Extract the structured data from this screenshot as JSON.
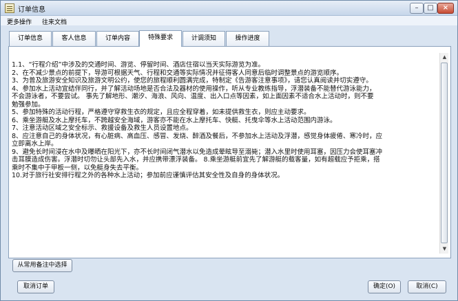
{
  "window": {
    "title": "订单信息",
    "buttons": {
      "minimize": "–",
      "maximize": "□",
      "close": "×"
    }
  },
  "menu": {
    "items": [
      "更多操作",
      "往来文档"
    ]
  },
  "tabs": [
    {
      "label": "订单信息"
    },
    {
      "label": "客人信息"
    },
    {
      "label": "订单内容"
    },
    {
      "label": "特殊要求"
    },
    {
      "label": "计调须知"
    },
    {
      "label": "操作进度"
    }
  ],
  "content": {
    "lines": [
      "1.1、“行程介绍”中涉及的交通时间、游览、停留时间、酒店住宿以当天实际游览为准。",
      "2、在不减少景点的前提下，导游可根据天气、行程和交通等实际情况并征得客人同意后临时调整景点的游览顺序。",
      "3、为普及旅游安全知识及旅游文明公约，使您的旅程顺利圆满完成，特制定《告游客注意事项》，请您认真阅读并切实遵守。",
      "4、参加水上活动宜结伴同行，并了解活动场地是否合法及器材的使用操作，听从专业教练指导，浮潜装备不能替代游泳能力，",
      "不会游泳者，不要尝试。 事先了解地形、潮汐、海浪、风向、温度、出入口点等因素，如上面因素不适合水上活动时，则不要",
      "勉强参加。",
      "5、参加特殊的活动行程，严格遵守穿救生衣的规定，且应全程穿着，如未提供救生衣，则应主动要求。",
      "6、乘坐游艇及水上摩托车，不跨越安全海域，游客亦不能在水上摩托车、快艇、托曳伞等水上活动范围内游泳。",
      "7、注意活动区域之安全标示、救援设备及救生人员设置地点。",
      "8、应注意自己的身体状况，有心脏病、高血压、感冒、发烧、醉酒及餐后，不参加水上活动及浮潜，感觉身体疲倦、寒冷时，应",
      "立即离水上岸。",
      "9、避免长时间浸在水中及曝晒在阳光下，亦不长时间闭气潜水以免造成晕眩导至溺毙；潜入水里时使用耳塞，因压力会使耳塞冲",
      "击耳膜造成伤害。浮潜时切勿让头部先入水，并应携带漂浮装备。 8.乘坐游艇前宜先了解游艇的载客量，如有超载应予拒乘，搭",
      "乘时不集中于甲板一侧，以免艇身失去平衡。",
      "10.对于旅行社安排行程之外的各种水上活动；参加前应谨慎评估其安全性及自身的身体状况。"
    ]
  },
  "buttons": {
    "pick_from_notes": "从常用备注中选择",
    "cancel_order": "取消订单",
    "ok": "确定(O)",
    "cancel": "取消(C)"
  }
}
